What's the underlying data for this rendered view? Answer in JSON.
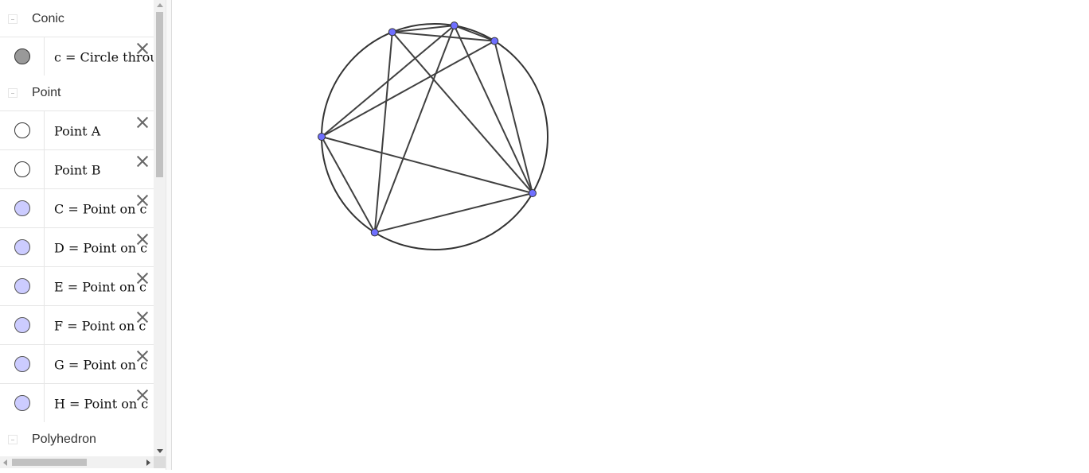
{
  "algebra": {
    "groups": [
      {
        "label": "Conic",
        "items": [
          {
            "text": "c = Circle through A, B, C",
            "style": "grey"
          }
        ]
      },
      {
        "label": "Point",
        "items": [
          {
            "text": "Point A",
            "style": "white"
          },
          {
            "text": "Point B",
            "style": "white"
          },
          {
            "text": "C = Point on c",
            "style": "blue"
          },
          {
            "text": "D = Point on c",
            "style": "blue"
          },
          {
            "text": "E = Point on c",
            "style": "blue"
          },
          {
            "text": "F = Point on c",
            "style": "blue"
          },
          {
            "text": "G = Point on c",
            "style": "blue"
          },
          {
            "text": "H = Point on c",
            "style": "blue"
          }
        ]
      },
      {
        "label": "Polyhedron",
        "items": []
      }
    ]
  },
  "figure": {
    "circle_color": "#333333",
    "segment_color": "#404040",
    "point_fill": "#6f6fff",
    "point_stroke": "#333333",
    "points_deg": [
      -112,
      -80,
      -58,
      180,
      122,
      30
    ],
    "segments": [
      [
        0,
        1
      ],
      [
        0,
        2
      ],
      [
        0,
        4
      ],
      [
        0,
        5
      ],
      [
        1,
        2
      ],
      [
        1,
        3
      ],
      [
        1,
        4
      ],
      [
        1,
        5
      ],
      [
        2,
        3
      ],
      [
        2,
        5
      ],
      [
        3,
        4
      ],
      [
        3,
        5
      ],
      [
        4,
        5
      ]
    ]
  }
}
